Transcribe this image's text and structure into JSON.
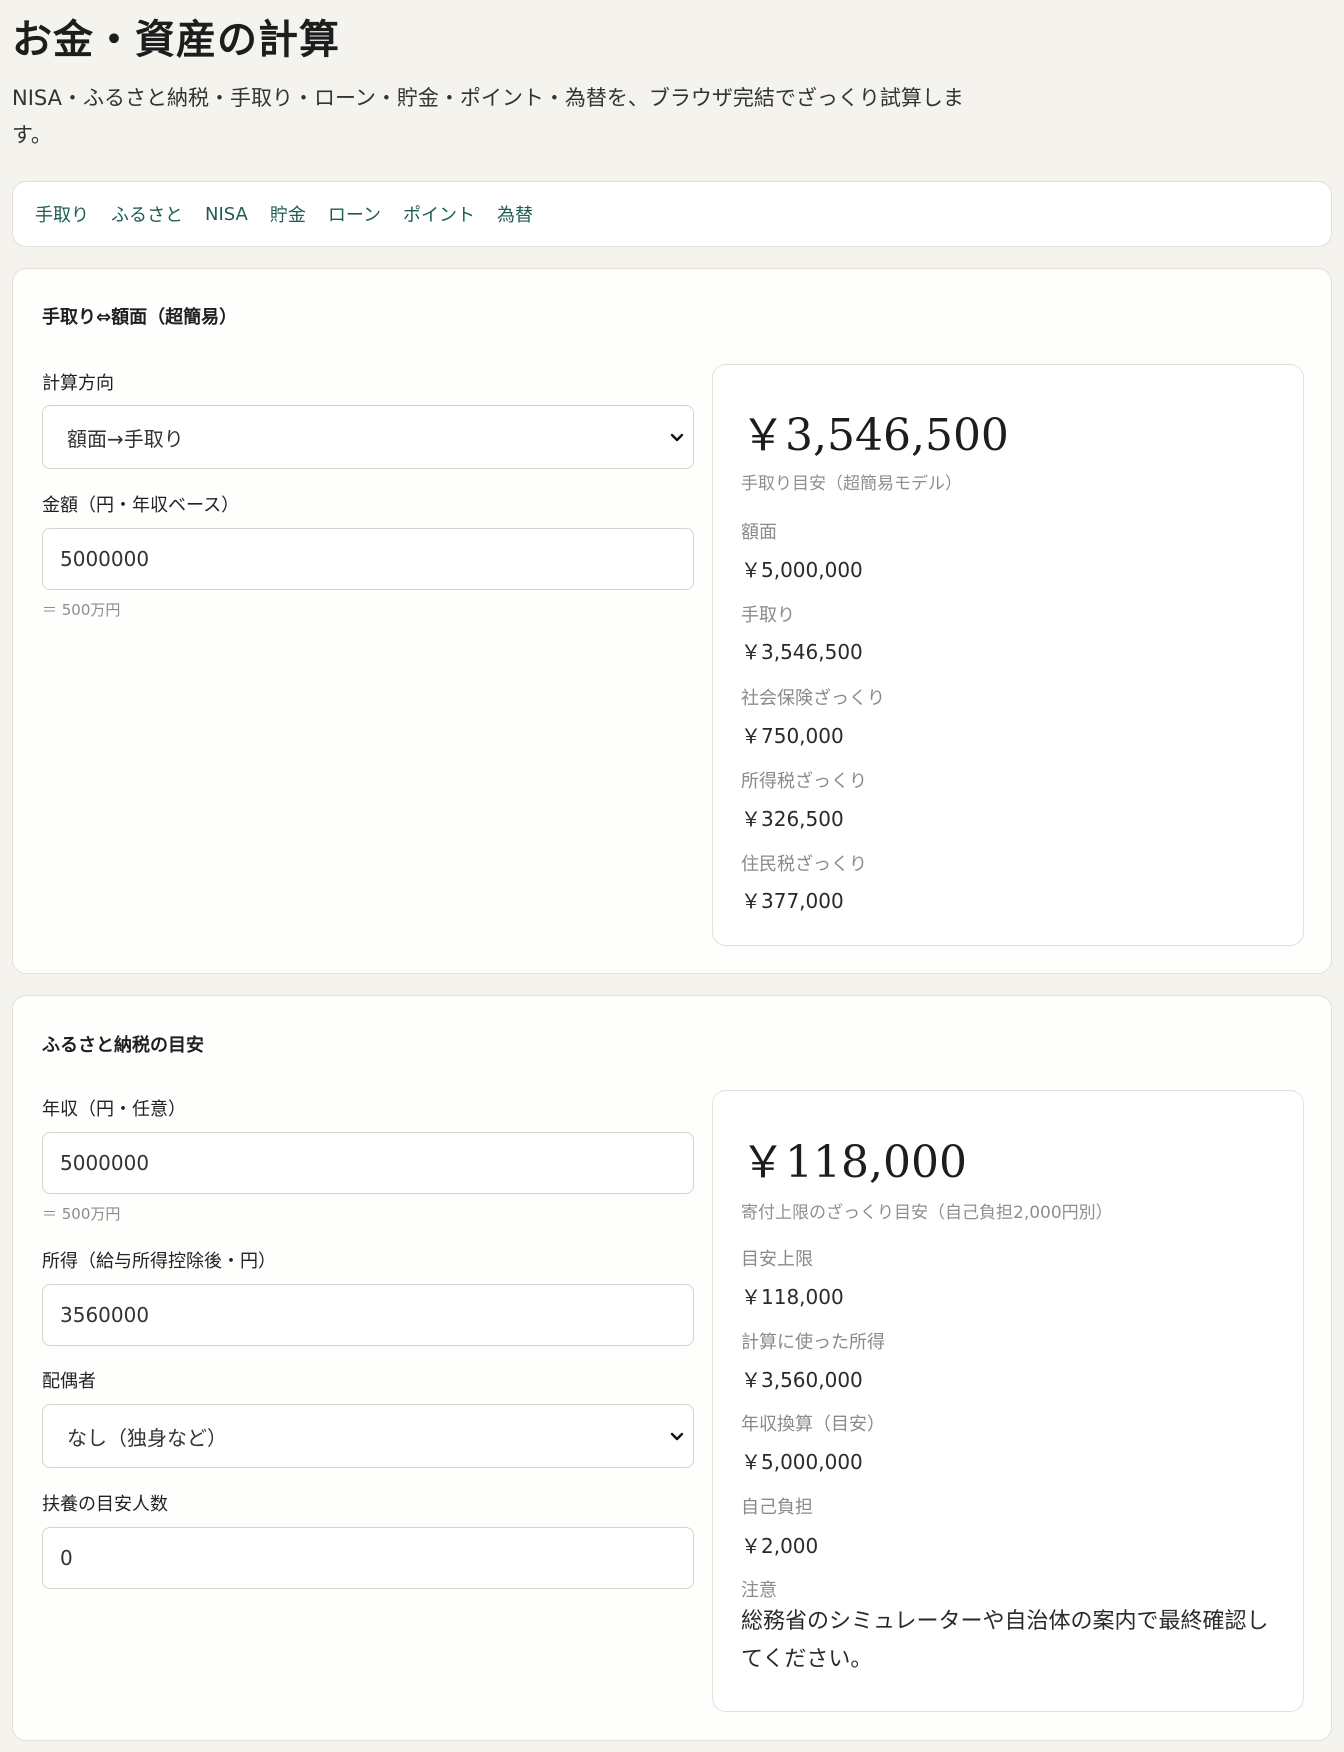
{
  "page": {
    "title": "お金・資産の計算",
    "description": "NISA・ふるさと納税・手取り・ローン・貯金・ポイント・為替を、ブラウザ完結でざっくり試算します。"
  },
  "nav": {
    "items": [
      {
        "label": "手取り"
      },
      {
        "label": "ふるさと"
      },
      {
        "label": "NISA"
      },
      {
        "label": "貯金"
      },
      {
        "label": "ローン"
      },
      {
        "label": "ポイント"
      },
      {
        "label": "為替"
      }
    ]
  },
  "takehome": {
    "title": "手取り⇔額面（超簡易）",
    "direction_label": "計算方向",
    "direction_value": "額面→手取り",
    "amount_label": "金額（円・年収ベース）",
    "amount_value": "5000000",
    "amount_hint": "＝ 500万円",
    "result": {
      "big": "￥3,546,500",
      "sub": "手取り目安（超簡易モデル）",
      "rows": [
        {
          "label": "額面",
          "value": "￥5,000,000"
        },
        {
          "label": "手取り",
          "value": "￥3,546,500"
        },
        {
          "label": "社会保険ざっくり",
          "value": "￥750,000"
        },
        {
          "label": "所得税ざっくり",
          "value": "￥326,500"
        },
        {
          "label": "住民税ざっくり",
          "value": "￥377,000"
        }
      ]
    }
  },
  "furusato": {
    "title": "ふるさと納税の目安",
    "income_label": "年収（円・任意）",
    "income_value": "5000000",
    "income_hint": "＝ 500万円",
    "shotoku_label": "所得（給与所得控除後・円）",
    "shotoku_value": "3560000",
    "spouse_label": "配偶者",
    "spouse_value": "なし（独身など）",
    "dependents_label": "扶養の目安人数",
    "dependents_value": "0",
    "result": {
      "big": "￥118,000",
      "sub": "寄付上限のざっくり目安（自己負担2,000円別）",
      "rows": [
        {
          "label": "目安上限",
          "value": "￥118,000"
        },
        {
          "label": "計算に使った所得",
          "value": "￥3,560,000"
        },
        {
          "label": "年収換算（目安）",
          "value": "￥5,000,000"
        },
        {
          "label": "自己負担",
          "value": "￥2,000"
        }
      ],
      "note_label": "注意",
      "note_text": "総務省のシミュレーターや自治体の案内で最終確認してください。"
    }
  }
}
